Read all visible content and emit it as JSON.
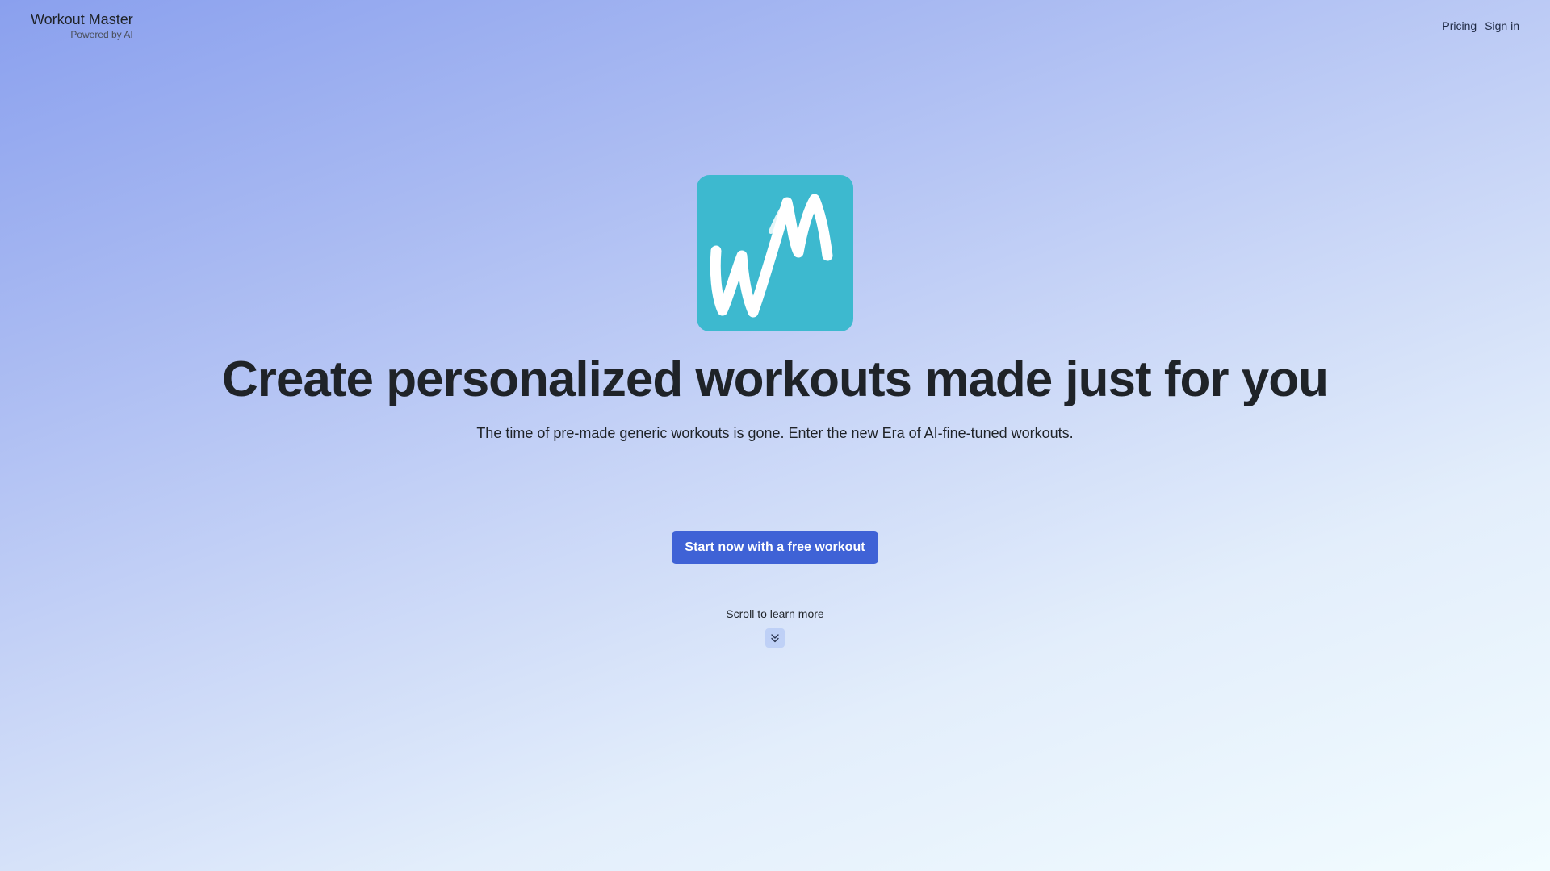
{
  "header": {
    "brand_name": "Workout Master",
    "brand_tagline": "Powered by AI",
    "nav": [
      {
        "label": "Pricing"
      },
      {
        "label": "Sign in"
      }
    ]
  },
  "hero": {
    "logo_icon": "wm-brush-logo-icon",
    "headline": "Create personalized workouts made just for you",
    "subtitle": "The time of pre-made generic workouts is gone. Enter the new Era of AI-fine-tuned workouts.",
    "cta_label": "Start now with a free workout",
    "scroll_hint": "Scroll to learn more",
    "scroll_icon": "double-chevron-down-icon"
  },
  "colors": {
    "logo_bg": "#3db9cf",
    "cta_bg": "#3f62d6"
  }
}
